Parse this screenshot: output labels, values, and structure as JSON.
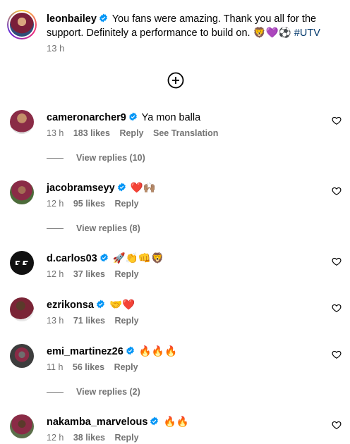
{
  "post": {
    "username": "leonbailey",
    "text": "You fans were amazing. Thank you all for the support. Definitely a performance to build on.",
    "emojis": "🦁💜⚽",
    "hashtag": "#UTV",
    "time": "13 h"
  },
  "comments": [
    {
      "username": "cameronarcher9",
      "text": "Ya mon balla",
      "time": "13 h",
      "likes": "183 likes",
      "reply": "Reply",
      "translate": "See Translation",
      "avatar_color": "#8a2b46"
    },
    {
      "username": "jacobramseyy",
      "text": "❤️🙌🏽",
      "time": "12 h",
      "likes": "95 likes",
      "reply": "Reply",
      "avatar_color": "#4c6b3a"
    },
    {
      "username": "d.carlos03",
      "text": "🚀👏👊🦁",
      "time": "12 h",
      "likes": "37 likes",
      "reply": "Reply",
      "avatar_color": "#111111"
    },
    {
      "username": "ezrikonsa",
      "text": "🤝❤️",
      "time": "13 h",
      "likes": "71 likes",
      "reply": "Reply",
      "avatar_color": "#7a2436"
    },
    {
      "username": "emi_martinez26",
      "text": "🔥🔥🔥",
      "time": "11 h",
      "likes": "56 likes",
      "reply": "Reply",
      "avatar_color": "#3d3d3d"
    },
    {
      "username": "nakamba_marvelous",
      "text": "🔥🔥",
      "time": "12 h",
      "likes": "38 likes",
      "reply": "Reply",
      "avatar_color": "#5b6f4a"
    }
  ],
  "view_replies": [
    "View replies (10)",
    "View replies (8)",
    "View replies (2)"
  ],
  "icons": {
    "verified": "verified-badge-icon",
    "heart": "heart-outline-icon",
    "load_more": "plus-circle-icon"
  },
  "colors": {
    "verified": "#0095f6",
    "secondary_text": "#737373",
    "hashtag": "#00376b"
  }
}
